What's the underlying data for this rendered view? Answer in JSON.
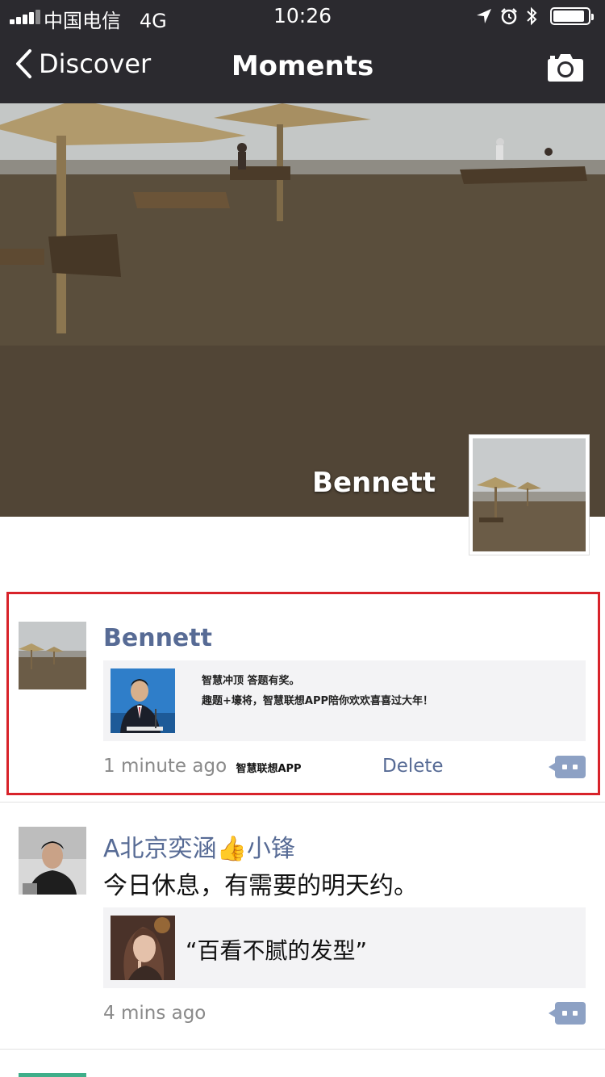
{
  "status_bar": {
    "carrier": "中国电信",
    "network": "4G",
    "time": "10:26",
    "battery_level": 0.9
  },
  "nav": {
    "back_label": "Discover",
    "title": "Moments"
  },
  "cover": {
    "user_name": "Bennett"
  },
  "posts": [
    {
      "author": "Bennett",
      "link": {
        "line1": "智慧冲顶  答题有奖。",
        "line2": "趣题+壕将，智慧联想APP陪你欢欢喜喜过大年！"
      },
      "time": "1 minute ago",
      "source": "智慧联想APP",
      "delete_label": "Delete"
    },
    {
      "author": "A北京奕涵👍小锋",
      "text": "今日休息，有需要的明天约。",
      "link": {
        "title": "“百看不腻的发型”"
      },
      "time": "4 mins ago"
    }
  ],
  "colors": {
    "nav_bar": "#2b2a2f",
    "author_name": "#576b95",
    "highlight_box": "#d8232a",
    "comment_button": "#8da1c4"
  }
}
